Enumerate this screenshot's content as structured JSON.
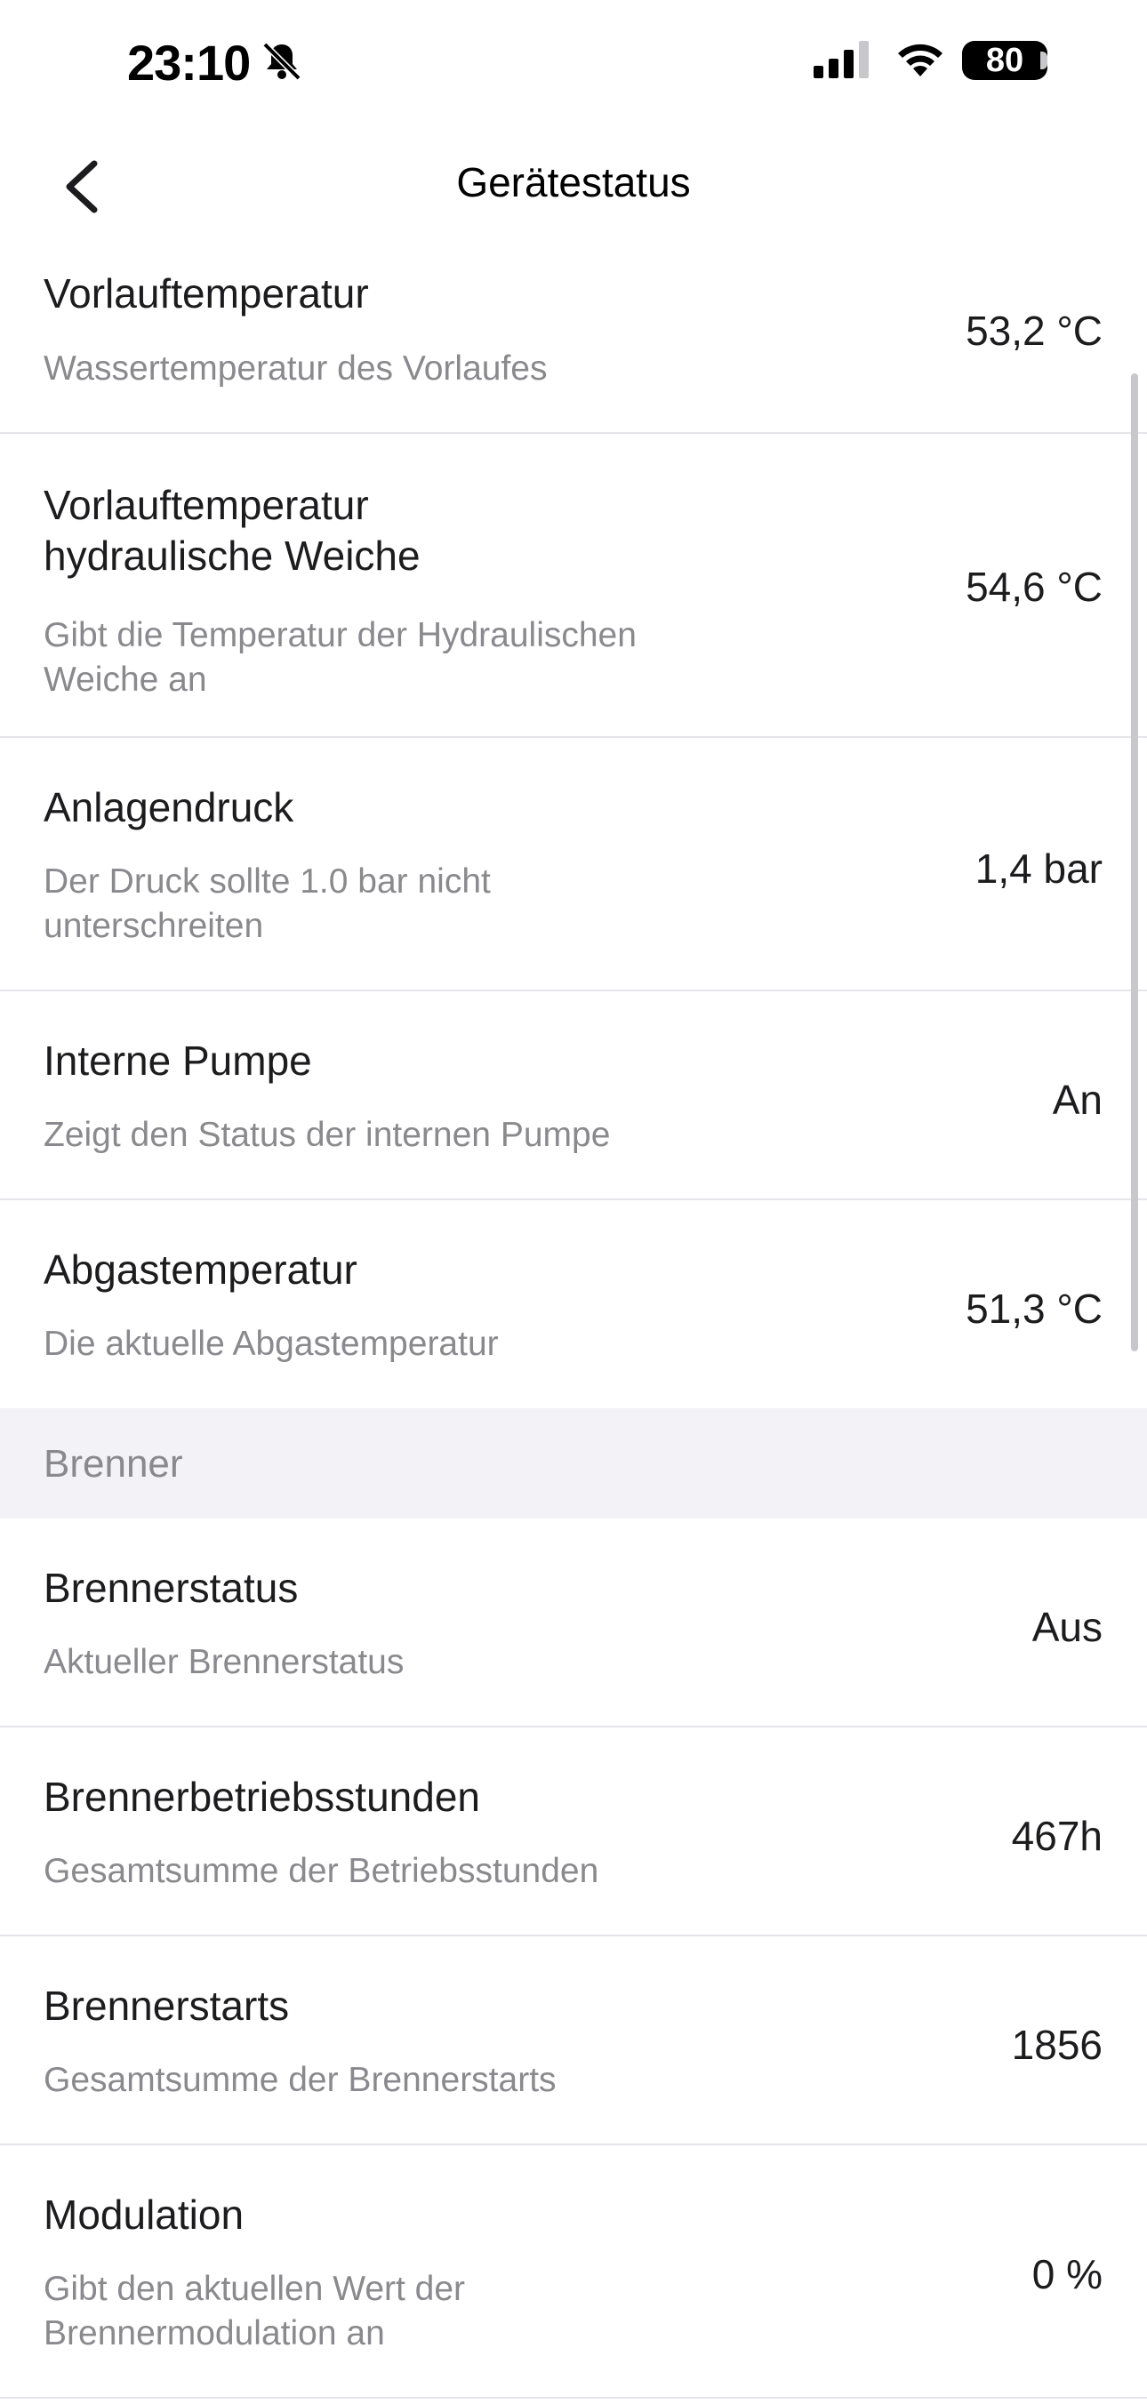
{
  "status_bar": {
    "time": "23:10",
    "battery": "80"
  },
  "nav": {
    "title": "Gerätestatus"
  },
  "rows_top": [
    {
      "title": "Vorlauftemperatur",
      "subtitle": "Wassertemperatur des Vorlaufes",
      "value": "53,2 °C"
    },
    {
      "title": "Vorlauftemperatur\nhydraulische Weiche",
      "subtitle": "Gibt die Temperatur der Hydraulischen\nWeiche an",
      "value": "54,6 °C"
    },
    {
      "title": "Anlagendruck",
      "subtitle": "Der Druck sollte 1.0 bar nicht\nunterschreiten",
      "value": "1,4 bar"
    },
    {
      "title": "Interne Pumpe",
      "subtitle": "Zeigt den Status der internen Pumpe",
      "value": "An"
    },
    {
      "title": "Abgastemperatur",
      "subtitle": "Die aktuelle Abgastemperatur",
      "value": "51,3 °C"
    }
  ],
  "section_brenner": "Brenner",
  "rows_brenner": [
    {
      "title": "Brennerstatus",
      "subtitle": "Aktueller Brennerstatus",
      "value": "Aus"
    },
    {
      "title": "Brennerbetriebsstunden",
      "subtitle": "Gesamtsumme der Betriebsstunden",
      "value": "467h"
    },
    {
      "title": "Brennerstarts",
      "subtitle": "Gesamtsumme der Brennerstarts",
      "value": "1856"
    },
    {
      "title": "Modulation",
      "subtitle": "Gibt den aktuellen Wert der\nBrennermodulation an",
      "value": "0 %"
    }
  ],
  "icons": {
    "back": "chevron-left-icon",
    "bell": "bell-slash-icon",
    "signal": "cellular-signal-icon",
    "wifi": "wifi-icon",
    "battery": "battery-icon"
  }
}
